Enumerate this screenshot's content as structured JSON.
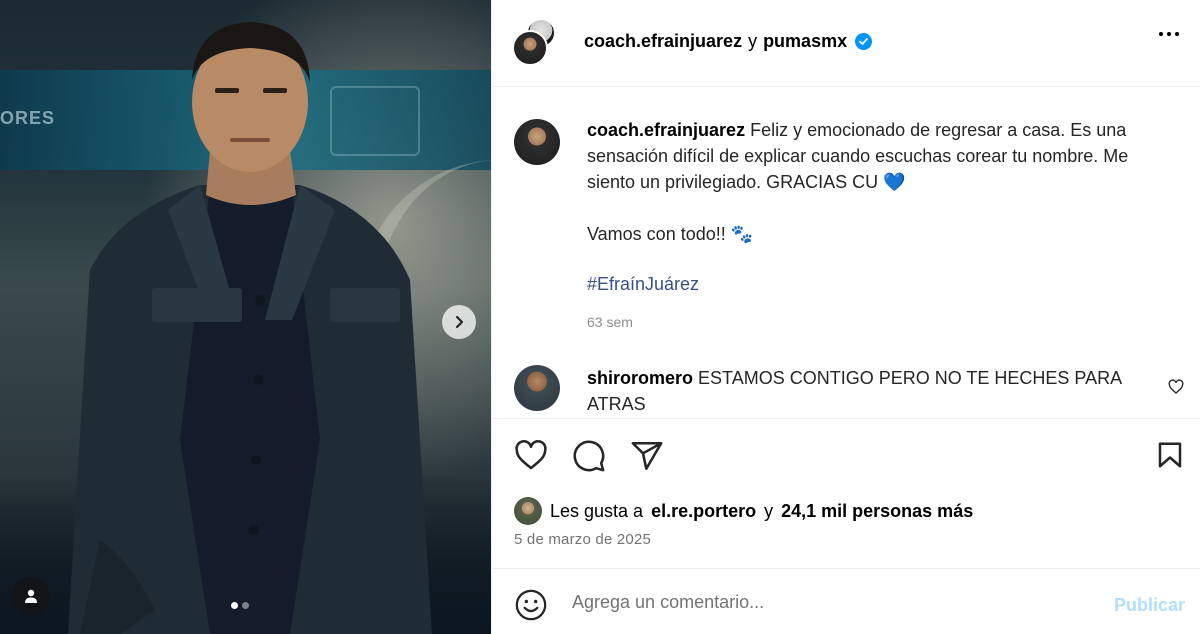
{
  "post": {
    "author_primary": "coach.efrainjuarez",
    "conjunction": "y",
    "author_secondary": "pumasmx",
    "verified": true
  },
  "media": {
    "banner_text": "ORES",
    "slides_total": 2,
    "slide_active": 1
  },
  "caption": {
    "username": "coach.efrainjuarez",
    "text": "Feliz y emocionado de regresar a casa. Es una sensación difícil de explicar cuando escuchas corear tu nombre. Me siento un privilegiado. GRACIAS CU",
    "emoji": "💙",
    "line2": "Vamos con todo!!",
    "line2_emoji": "🐾",
    "hashtag": "#EfraínJuárez",
    "time": "63 sem"
  },
  "comments": [
    {
      "username": "shiroromero",
      "text": "ESTAMOS CONTIGO PERO NO TE HECHES PARA ATRAS"
    }
  ],
  "likes": {
    "prefix": "Les gusta a",
    "first_user": "el.re.portero",
    "joiner": "y",
    "others": "24,1 mil personas más"
  },
  "date": "5 de marzo de 2025",
  "add_comment": {
    "placeholder": "Agrega un comentario...",
    "publish_label": "Publicar"
  },
  "colors": {
    "verified": "#0095f6",
    "hashtag": "#385185",
    "publish_disabled": "#b2dffc",
    "secondary_text": "#737373"
  },
  "icons": [
    "chevron-right-icon",
    "user-tag-icon",
    "more-icon",
    "verified-icon",
    "heart-icon",
    "comment-icon",
    "share-icon",
    "bookmark-icon",
    "emoji-icon"
  ]
}
